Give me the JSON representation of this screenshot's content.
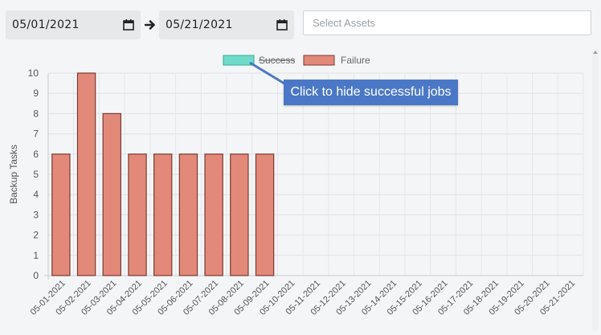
{
  "filters": {
    "start_date": "05/01/2021",
    "end_date": "05/21/2021",
    "assets_placeholder": "Select Assets"
  },
  "tooltip": {
    "text": "Click to hide successful jobs"
  },
  "colors": {
    "success": "#6fdcc9",
    "failure": "#e3897a",
    "failure_border": "#7a3a30"
  },
  "chart_data": {
    "type": "bar",
    "ylabel": "Backup Tasks",
    "xlabel": "",
    "ylim": [
      0,
      10
    ],
    "yticks": [
      0,
      1,
      2,
      3,
      4,
      5,
      6,
      7,
      8,
      9,
      10
    ],
    "categories": [
      "05-01-2021",
      "05-02-2021",
      "05-03-2021",
      "05-04-2021",
      "05-05-2021",
      "05-06-2021",
      "05-07-2021",
      "05-08-2021",
      "05-09-2021",
      "05-10-2021",
      "05-11-2021",
      "05-12-2021",
      "05-13-2021",
      "05-14-2021",
      "05-15-2021",
      "05-16-2021",
      "05-17-2021",
      "05-18-2021",
      "05-19-2021",
      "05-20-2021",
      "05-21-2021"
    ],
    "series": [
      {
        "name": "Success",
        "hidden": true,
        "values": [
          0,
          0,
          0,
          0,
          0,
          0,
          0,
          0,
          0,
          0,
          0,
          0,
          0,
          0,
          0,
          0,
          0,
          0,
          0,
          0,
          0
        ]
      },
      {
        "name": "Failure",
        "hidden": false,
        "values": [
          6,
          10,
          8,
          6,
          6,
          6,
          6,
          6,
          6,
          0,
          0,
          0,
          0,
          0,
          0,
          0,
          0,
          0,
          0,
          0,
          0
        ]
      }
    ],
    "legend_position": "top",
    "grid": true
  }
}
